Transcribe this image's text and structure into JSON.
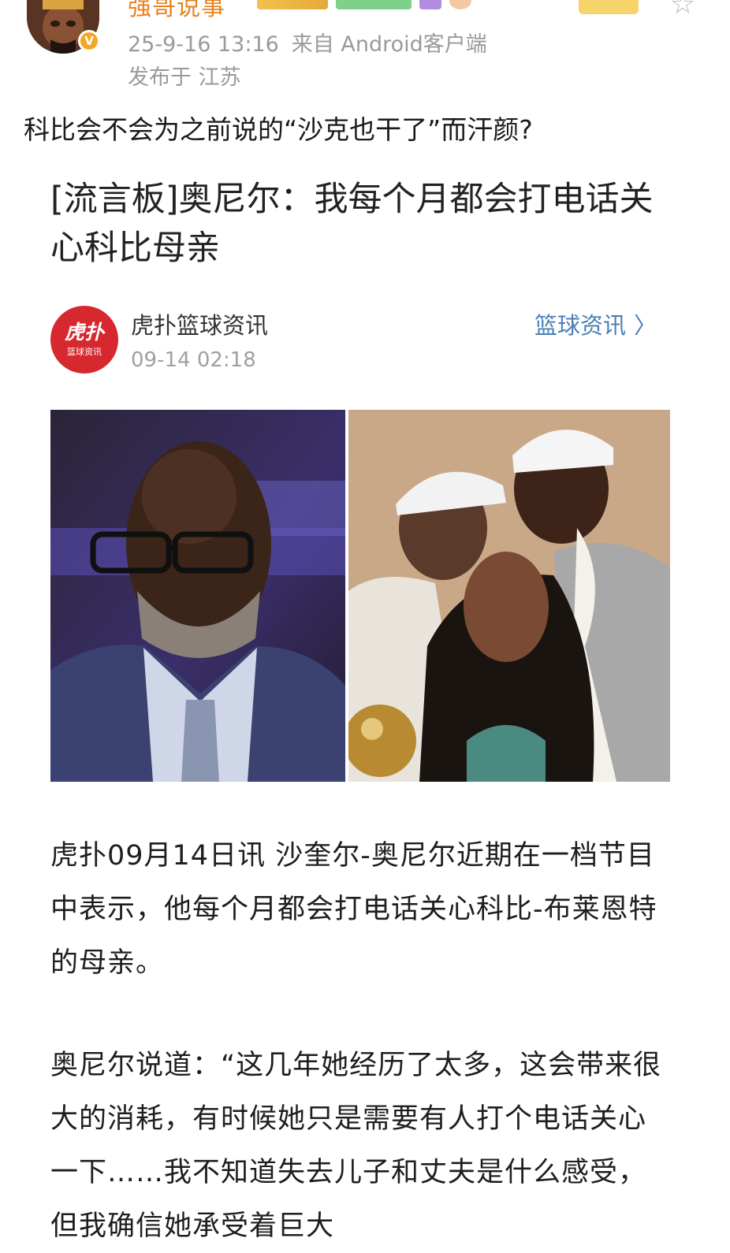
{
  "post": {
    "username": "强哥说事",
    "timestamp": "25-9-16 13:16",
    "source": "来自 Android客户端",
    "location": "发布于 江苏",
    "text": "科比会不会为之前说的“沙克也干了”而汗颜?",
    "verified_badge": "V",
    "star_icon": "star-icon"
  },
  "article": {
    "title": "[流言板]奥尼尔：我每个月都会打电话关心科比母亲",
    "publisher": {
      "logo_line1": "虎扑",
      "logo_line2": "篮球资讯",
      "name": "虎扑篮球资讯",
      "time": "09-14 02:18",
      "category_link": "篮球资讯",
      "chevron": "〉"
    },
    "paragraphs": [
      "虎扑09月14日讯 沙奎尔-奥尼尔近期在一档节目中表示，他每个月都会打电话关心科比-布莱恩特的母亲。",
      "奥尼尔说道：“这几年她经历了太多，这会带来很大的消耗，有时候她只是需要有人打个电话关心一下……我不知道失去儿子和丈夫是什么感受，但我确信她承受着巨大"
    ]
  },
  "colors": {
    "username": "#e8821e",
    "link": "#4a7fb5",
    "brand_red": "#d7282f",
    "meta_gray": "#9a9a9a"
  }
}
